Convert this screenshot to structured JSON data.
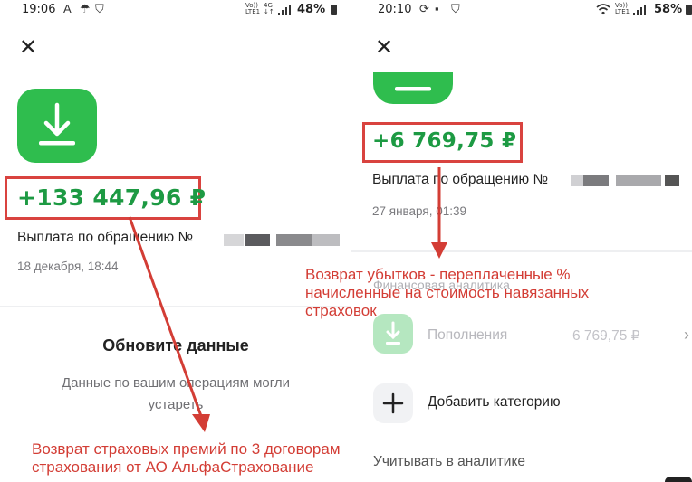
{
  "left": {
    "status": {
      "time": "19:06",
      "net_top": "Vo))",
      "net_bottom": "LTE1",
      "net2_top": "4G",
      "net2_bottom": "↓↑",
      "battery": "48%"
    },
    "amount": "+133 447,96 ₽",
    "description": "Выплата по обращению №",
    "date": "18 декабря, 18:44",
    "update_title": "Обновите данные",
    "update_text": "Данные по вашим операциям могли устареть",
    "annotation": "Возврат страховых премий по 3 договорам страхования от АО АльфаСтрахование"
  },
  "right": {
    "status": {
      "time": "20:10",
      "net_top": "Vo))",
      "net_bottom": "LTE1",
      "battery": "58%"
    },
    "amount": "+6 769,75 ₽",
    "description": "Выплата по обращению №",
    "date": "27 января, 01:39",
    "section_title": "Финансовая аналитика",
    "category": {
      "label": "Пополнения",
      "value": "6 769,75 ₽"
    },
    "add_category": "Добавить категорию",
    "analytics_toggle": "Учитывать в аналитике",
    "annotation": "Возврат убытков - переплаченные % начисленные на стоимость навязанных страховок"
  },
  "colors": {
    "brand_green": "#2fbd4e",
    "amount_green": "#1d9a43",
    "annotation_red": "#d33d35"
  },
  "icons": [
    "close-icon",
    "download-icon",
    "plus-icon",
    "chevron-right-icon",
    "signal-icon",
    "wifi-icon",
    "battery-icon",
    "message-icon",
    "shield-icon"
  ]
}
